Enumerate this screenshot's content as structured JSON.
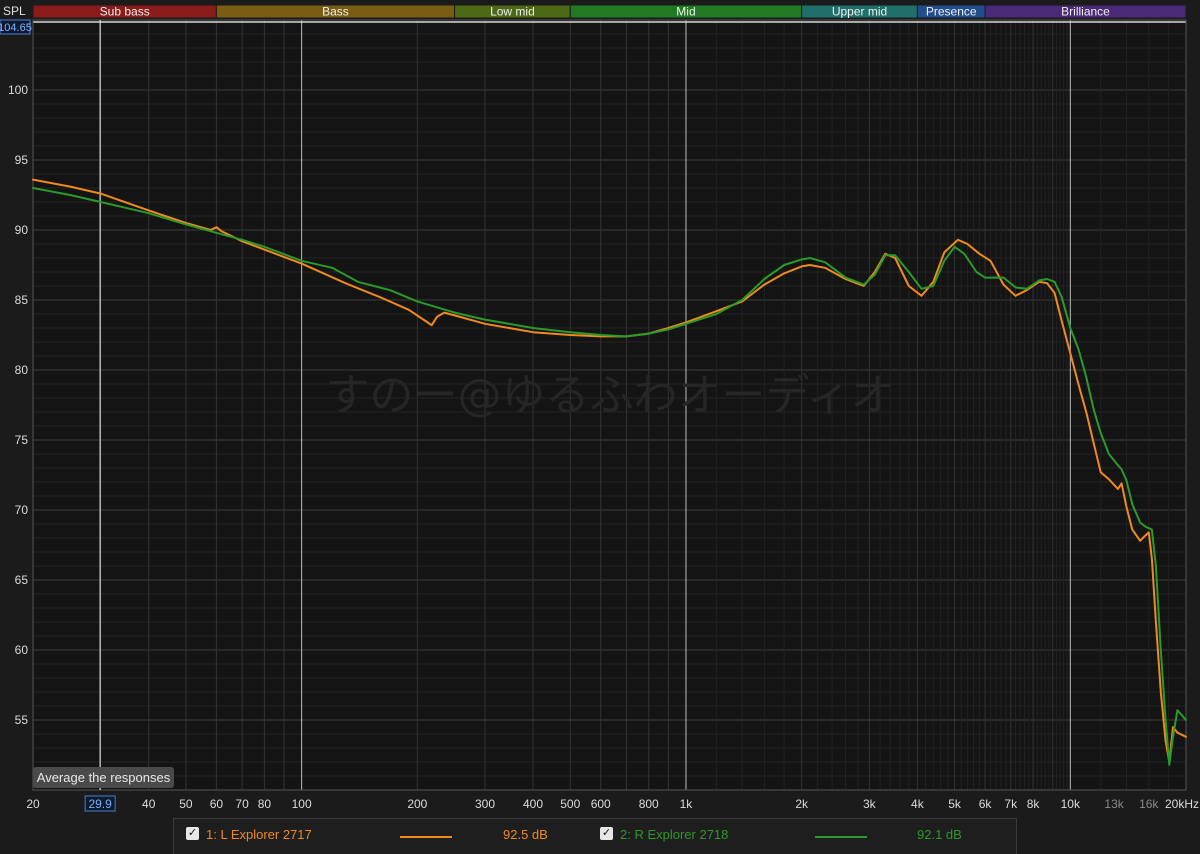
{
  "chart_data": {
    "type": "line",
    "y_axis_label": "SPL",
    "cursor_y_readout": "104.65",
    "cursor_x_readout": "29.9",
    "ylim": [
      50,
      105
    ],
    "xlim_hz": [
      20,
      20000
    ],
    "x_scale": "log",
    "grid": true,
    "y_ticks": [
      55,
      60,
      65,
      70,
      75,
      80,
      85,
      90,
      95,
      100
    ],
    "x_ticks": [
      {
        "hz": 20,
        "label": "20",
        "dim": false
      },
      {
        "hz": 40,
        "label": "40",
        "dim": false
      },
      {
        "hz": 50,
        "label": "50",
        "dim": false
      },
      {
        "hz": 60,
        "label": "60",
        "dim": false
      },
      {
        "hz": 70,
        "label": "70",
        "dim": false
      },
      {
        "hz": 80,
        "label": "80",
        "dim": false
      },
      {
        "hz": 100,
        "label": "100",
        "dim": false
      },
      {
        "hz": 200,
        "label": "200",
        "dim": false
      },
      {
        "hz": 300,
        "label": "300",
        "dim": false
      },
      {
        "hz": 400,
        "label": "400",
        "dim": false
      },
      {
        "hz": 500,
        "label": "500",
        "dim": false
      },
      {
        "hz": 600,
        "label": "600",
        "dim": false
      },
      {
        "hz": 800,
        "label": "800",
        "dim": false
      },
      {
        "hz": 1000,
        "label": "1k",
        "dim": false
      },
      {
        "hz": 2000,
        "label": "2k",
        "dim": false
      },
      {
        "hz": 3000,
        "label": "3k",
        "dim": false
      },
      {
        "hz": 4000,
        "label": "4k",
        "dim": false
      },
      {
        "hz": 5000,
        "label": "5k",
        "dim": false
      },
      {
        "hz": 6000,
        "label": "6k",
        "dim": false
      },
      {
        "hz": 7000,
        "label": "7k",
        "dim": false
      },
      {
        "hz": 8000,
        "label": "8k",
        "dim": false
      },
      {
        "hz": 10000,
        "label": "10k",
        "dim": false
      },
      {
        "hz": 13000,
        "label": "13k",
        "dim": true
      },
      {
        "hz": 16000,
        "label": "16k",
        "dim": true
      },
      {
        "hz": 20000,
        "label": "20kHz",
        "dim": false
      }
    ],
    "bands": [
      {
        "name": "Sub bass",
        "from_hz": 20,
        "to_hz": 60,
        "color": "#8b1a1a"
      },
      {
        "name": "Bass",
        "from_hz": 60,
        "to_hz": 250,
        "color": "#7a5c12"
      },
      {
        "name": "Low mid",
        "from_hz": 250,
        "to_hz": 500,
        "color": "#4c6a15"
      },
      {
        "name": "Mid",
        "from_hz": 500,
        "to_hz": 2000,
        "color": "#1f7a22"
      },
      {
        "name": "Upper mid",
        "from_hz": 2000,
        "to_hz": 4000,
        "color": "#1f6f6a"
      },
      {
        "name": "Presence",
        "from_hz": 4000,
        "to_hz": 6000,
        "color": "#214d8c"
      },
      {
        "name": "Brilliance",
        "from_hz": 6000,
        "to_hz": 20000,
        "color": "#4a2a78"
      }
    ],
    "cursor_hz": 29.9,
    "watermark": "すのー@ゆるふわオーディオ",
    "series": [
      {
        "name": "1: L Explorer 2717",
        "color": "#f08a1e",
        "level": "92.5 dB",
        "points": [
          [
            20,
            93.6
          ],
          [
            25,
            93.1
          ],
          [
            30,
            92.6
          ],
          [
            40,
            91.4
          ],
          [
            50,
            90.5
          ],
          [
            58,
            90.0
          ],
          [
            60,
            90.2
          ],
          [
            62,
            89.9
          ],
          [
            70,
            89.2
          ],
          [
            80,
            88.6
          ],
          [
            100,
            87.6
          ],
          [
            130,
            86.2
          ],
          [
            160,
            85.2
          ],
          [
            190,
            84.3
          ],
          [
            210,
            83.5
          ],
          [
            218,
            83.2
          ],
          [
            225,
            83.8
          ],
          [
            235,
            84.1
          ],
          [
            250,
            83.9
          ],
          [
            300,
            83.3
          ],
          [
            400,
            82.7
          ],
          [
            500,
            82.5
          ],
          [
            600,
            82.4
          ],
          [
            700,
            82.4
          ],
          [
            800,
            82.6
          ],
          [
            900,
            83.0
          ],
          [
            1000,
            83.4
          ],
          [
            1200,
            84.2
          ],
          [
            1400,
            84.9
          ],
          [
            1600,
            86.1
          ],
          [
            1800,
            86.9
          ],
          [
            2000,
            87.4
          ],
          [
            2100,
            87.5
          ],
          [
            2300,
            87.3
          ],
          [
            2600,
            86.5
          ],
          [
            2900,
            86.0
          ],
          [
            3100,
            87.0
          ],
          [
            3300,
            88.3
          ],
          [
            3500,
            88.0
          ],
          [
            3800,
            86.0
          ],
          [
            4100,
            85.3
          ],
          [
            4400,
            86.3
          ],
          [
            4700,
            88.4
          ],
          [
            5100,
            89.3
          ],
          [
            5400,
            89.0
          ],
          [
            5800,
            88.3
          ],
          [
            6200,
            87.8
          ],
          [
            6700,
            86.1
          ],
          [
            7200,
            85.3
          ],
          [
            7700,
            85.7
          ],
          [
            8300,
            86.3
          ],
          [
            8700,
            86.2
          ],
          [
            9100,
            85.5
          ],
          [
            9500,
            83.5
          ],
          [
            10000,
            81.2
          ],
          [
            10500,
            79.0
          ],
          [
            11000,
            77.0
          ],
          [
            11500,
            74.8
          ],
          [
            12000,
            72.7
          ],
          [
            12600,
            72.2
          ],
          [
            13300,
            71.5
          ],
          [
            13600,
            71.9
          ],
          [
            14000,
            70.2
          ],
          [
            14500,
            68.6
          ],
          [
            15200,
            67.8
          ],
          [
            15700,
            68.2
          ],
          [
            16000,
            68.4
          ],
          [
            16300,
            66.5
          ],
          [
            16700,
            62.0
          ],
          [
            17200,
            57.0
          ],
          [
            17700,
            53.5
          ],
          [
            18100,
            52.0
          ],
          [
            18500,
            54.5
          ],
          [
            19000,
            54.1
          ],
          [
            20000,
            53.8
          ]
        ]
      },
      {
        "name": "2: R Explorer 2718",
        "color": "#2a9a2a",
        "level": "92.1 dB",
        "points": [
          [
            20,
            93.0
          ],
          [
            25,
            92.5
          ],
          [
            30,
            92.0
          ],
          [
            40,
            91.2
          ],
          [
            50,
            90.4
          ],
          [
            60,
            89.8
          ],
          [
            70,
            89.3
          ],
          [
            80,
            88.8
          ],
          [
            100,
            87.8
          ],
          [
            120,
            87.3
          ],
          [
            140,
            86.3
          ],
          [
            170,
            85.7
          ],
          [
            200,
            84.9
          ],
          [
            250,
            84.1
          ],
          [
            300,
            83.6
          ],
          [
            400,
            83.0
          ],
          [
            500,
            82.7
          ],
          [
            600,
            82.5
          ],
          [
            700,
            82.4
          ],
          [
            800,
            82.6
          ],
          [
            900,
            82.9
          ],
          [
            1000,
            83.3
          ],
          [
            1200,
            84.0
          ],
          [
            1400,
            85.0
          ],
          [
            1600,
            86.5
          ],
          [
            1800,
            87.5
          ],
          [
            2000,
            87.9
          ],
          [
            2100,
            88.0
          ],
          [
            2300,
            87.7
          ],
          [
            2600,
            86.6
          ],
          [
            2900,
            86.1
          ],
          [
            3100,
            86.8
          ],
          [
            3300,
            88.2
          ],
          [
            3500,
            88.2
          ],
          [
            3800,
            87.0
          ],
          [
            4100,
            85.8
          ],
          [
            4400,
            86.0
          ],
          [
            4700,
            87.8
          ],
          [
            5000,
            88.8
          ],
          [
            5300,
            88.3
          ],
          [
            5700,
            87.0
          ],
          [
            6000,
            86.6
          ],
          [
            6700,
            86.6
          ],
          [
            7200,
            85.9
          ],
          [
            7700,
            85.8
          ],
          [
            8300,
            86.4
          ],
          [
            8700,
            86.5
          ],
          [
            9100,
            86.3
          ],
          [
            9500,
            85.2
          ],
          [
            10000,
            83.0
          ],
          [
            10500,
            81.5
          ],
          [
            11000,
            79.5
          ],
          [
            11500,
            77.2
          ],
          [
            12000,
            75.5
          ],
          [
            12600,
            74.0
          ],
          [
            13300,
            73.2
          ],
          [
            13600,
            72.9
          ],
          [
            14000,
            72.1
          ],
          [
            14500,
            70.4
          ],
          [
            15200,
            69.1
          ],
          [
            15700,
            68.8
          ],
          [
            16300,
            68.6
          ],
          [
            16700,
            66.0
          ],
          [
            17200,
            60.0
          ],
          [
            17700,
            55.0
          ],
          [
            18100,
            51.8
          ],
          [
            18500,
            53.8
          ],
          [
            19000,
            55.7
          ],
          [
            20000,
            55.0
          ]
        ]
      }
    ]
  },
  "ui": {
    "average_button": "Average the responses",
    "check_glyph": "✓"
  }
}
